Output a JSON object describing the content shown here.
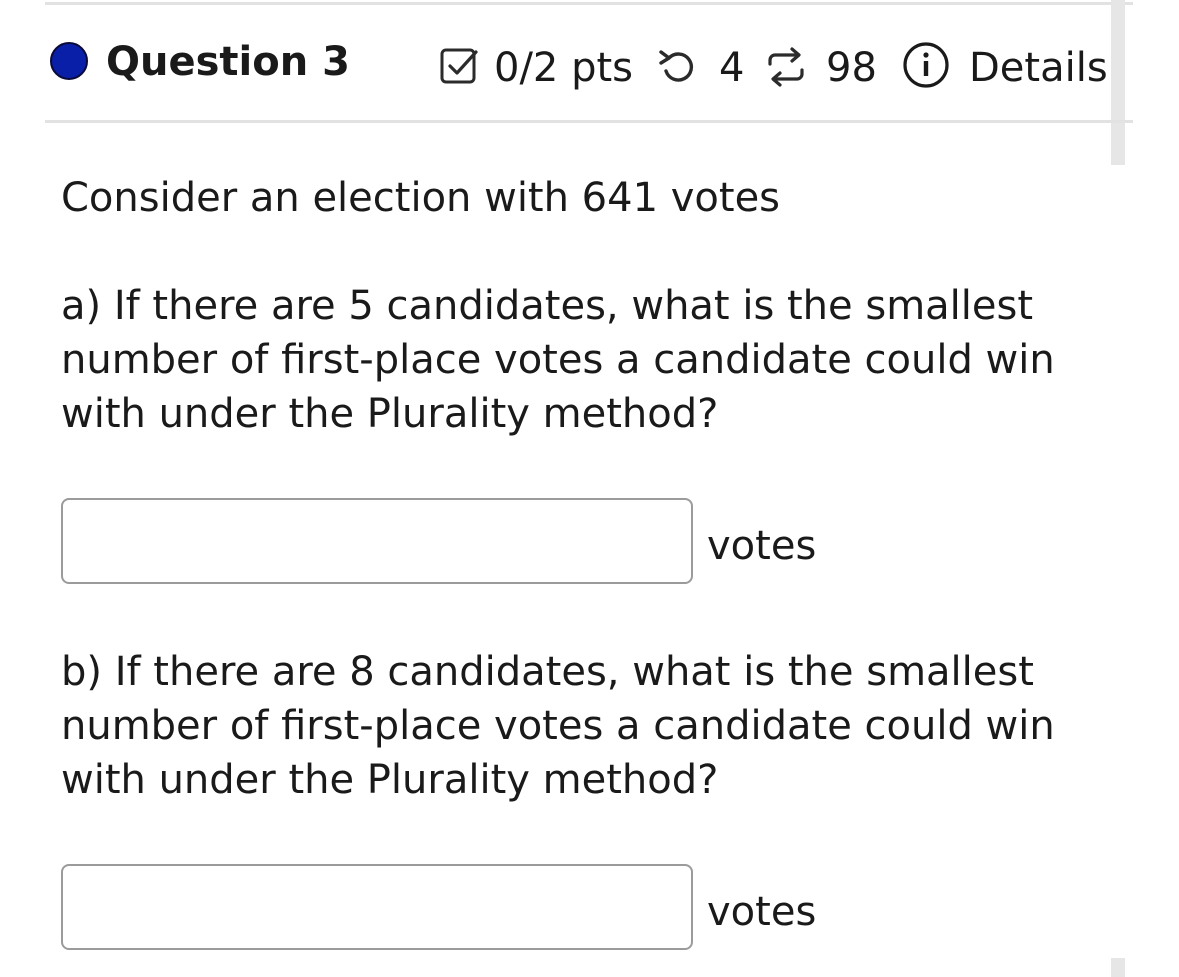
{
  "question": {
    "title": "Question 3",
    "points": "0/2 pts",
    "retries": "4",
    "attempts": "98",
    "details_label": "Details",
    "accent_color": "#0a1fa8"
  },
  "body": {
    "intro": "Consider an election with 641 votes",
    "part_a": {
      "lines": [
        "a) If there are 5 candidates, what is the smallest",
        "number of first-place votes a candidate could win",
        "with under the Plurality method?"
      ],
      "value": "",
      "unit": "votes"
    },
    "part_b": {
      "lines": [
        "b) If there are 8 candidates, what is the smallest",
        "number of first-place votes a candidate could win",
        "with under the Plurality method?"
      ],
      "value": "",
      "unit": "votes"
    }
  },
  "icons": {
    "status": "question-status-dot",
    "score": "checkbox-icon",
    "retry": "retry-icon",
    "attempts": "attempts-icon",
    "info": "info-icon"
  }
}
